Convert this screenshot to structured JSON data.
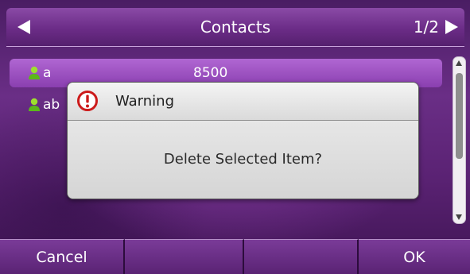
{
  "header": {
    "title": "Contacts",
    "page_indicator": "1/2"
  },
  "contacts": [
    {
      "name": "a",
      "number": "8500"
    },
    {
      "name": "ab",
      "number": ""
    }
  ],
  "dialog": {
    "title": "Warning",
    "message": "Delete Selected Item?"
  },
  "softkeys": [
    "Cancel",
    "",
    "",
    "OK"
  ],
  "colors": {
    "accent": "#6a2e86",
    "selected": "#9a50c0",
    "warning": "#cc1b1b"
  }
}
